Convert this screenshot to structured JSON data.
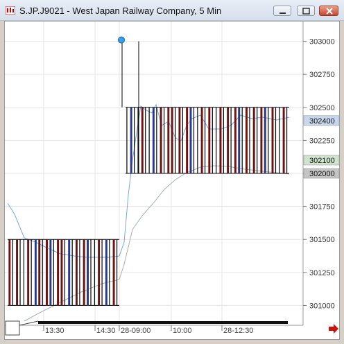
{
  "window": {
    "title": "S.JP.J9021 - West Japan Railway Company, 5 Min"
  },
  "price_axis": {
    "ticks": [
      "303000",
      "302750",
      "302500",
      "302250",
      "302000",
      "301750",
      "301500",
      "301250",
      "301000"
    ],
    "badges": [
      {
        "label": "302400",
        "color": "#c8d8ec"
      },
      {
        "label": "302100",
        "color": "#cfe3cf"
      },
      {
        "label": "302000",
        "color": "#c4c4c4"
      }
    ]
  },
  "time_axis": {
    "labels": [
      "13:30",
      "14:30",
      "28-09:00",
      "10:00",
      "28-12:30"
    ]
  },
  "chart_data": {
    "type": "bar",
    "ylim": [
      300850,
      303150
    ],
    "session1": {
      "open": 301500,
      "close": 301000,
      "bars": 30
    },
    "session2": {
      "open": 302500,
      "close": 302000,
      "bars": 44
    },
    "spike": {
      "high": 303000,
      "low": 302500
    },
    "colors": {
      "up": "#2a3a8a",
      "down": "#6b1414",
      "neutral": "#000000",
      "ma1": "#7da6d6",
      "ma2": "#a8b0b0"
    }
  }
}
